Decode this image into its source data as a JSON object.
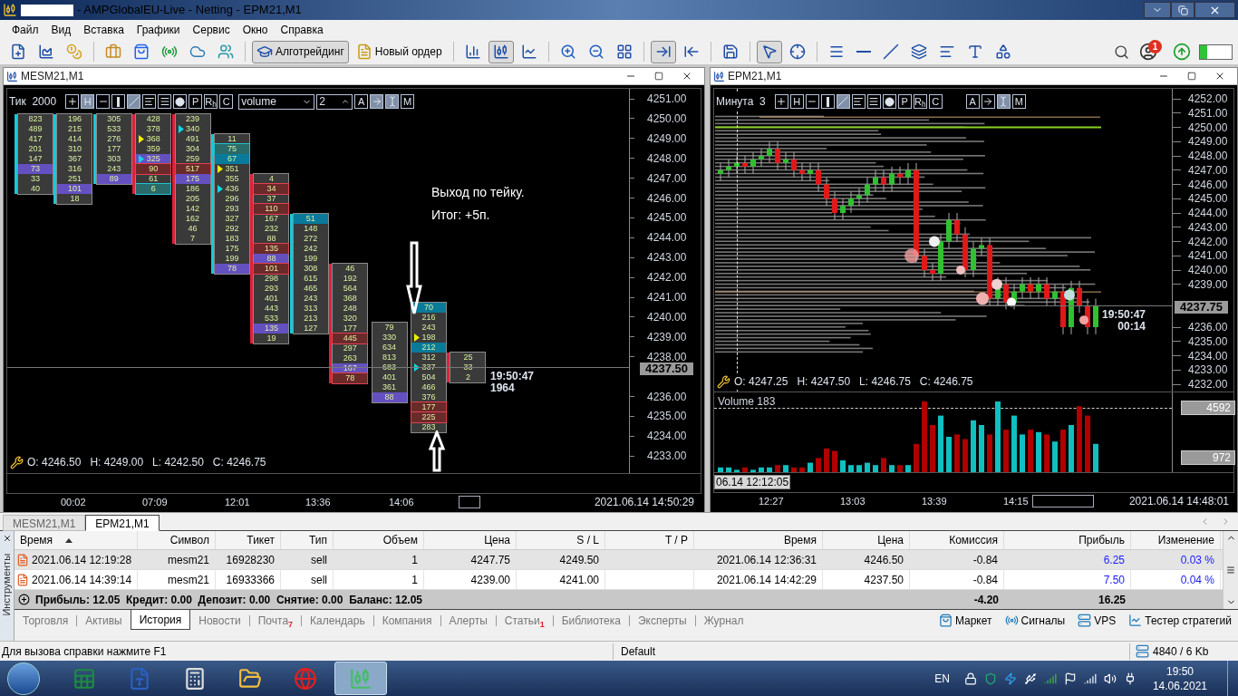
{
  "window": {
    "title": "- AMPGlobalEU-Live - Netting - EPM21,M1"
  },
  "menu": [
    "Файл",
    "Вид",
    "Вставка",
    "Графики",
    "Сервис",
    "Окно",
    "Справка"
  ],
  "toolbar": [
    {
      "kind": "new-chart",
      "pressed": false
    },
    {
      "kind": "templates",
      "pressed": false
    },
    {
      "kind": "profiles",
      "pressed": false
    },
    {
      "kind": "sep"
    },
    {
      "kind": "market",
      "pressed": false
    },
    {
      "kind": "shop",
      "pressed": false
    },
    {
      "kind": "signals",
      "pressed": false
    },
    {
      "kind": "vps",
      "pressed": false
    },
    {
      "kind": "community",
      "pressed": false
    },
    {
      "kind": "sep"
    },
    {
      "kind": "algo",
      "label": "Алготрейдинг",
      "pressed": true
    },
    {
      "kind": "order",
      "label": "Новый ордер",
      "pressed": false
    },
    {
      "kind": "sep"
    },
    {
      "kind": "bars",
      "pressed": false
    },
    {
      "kind": "candles",
      "pressed": true
    },
    {
      "kind": "line",
      "pressed": false
    },
    {
      "kind": "sep"
    },
    {
      "kind": "zoom-in",
      "pressed": false
    },
    {
      "kind": "zoom-out",
      "pressed": false
    },
    {
      "kind": "tile",
      "pressed": false
    },
    {
      "kind": "sep"
    },
    {
      "kind": "autoscroll",
      "pressed": true
    },
    {
      "kind": "shift",
      "pressed": false
    },
    {
      "kind": "sep"
    },
    {
      "kind": "save",
      "pressed": false
    },
    {
      "kind": "sep"
    },
    {
      "kind": "cursor",
      "pressed": true
    },
    {
      "kind": "crosshair",
      "pressed": false
    },
    {
      "kind": "sep"
    },
    {
      "kind": "vline",
      "pressed": false
    },
    {
      "kind": "hline",
      "pressed": false
    },
    {
      "kind": "trend",
      "pressed": false
    },
    {
      "kind": "channel",
      "pressed": false
    },
    {
      "kind": "fibo",
      "pressed": false
    },
    {
      "kind": "text",
      "pressed": false
    },
    {
      "kind": "shapes",
      "pressed": false
    }
  ],
  "notifications": {
    "count": "1"
  },
  "left_chart": {
    "title": "MESM21,M1",
    "period": "Тик",
    "size": "2000",
    "tools": [
      {
        "kind": "plus",
        "on": false
      },
      {
        "kind": "letter",
        "label": "H",
        "on": true
      },
      {
        "kind": "minus",
        "on": false
      },
      {
        "kind": "bar",
        "on": false
      },
      {
        "kind": "slash",
        "on": true
      },
      {
        "kind": "lines",
        "on": false
      },
      {
        "kind": "fibo",
        "on": false
      },
      {
        "kind": "dot",
        "on": false
      },
      {
        "kind": "letter",
        "label": "P",
        "on": false
      },
      {
        "kind": "letter",
        "label": "R$_{h}$",
        "on": false
      },
      {
        "kind": "letter",
        "label": "C",
        "on": false
      }
    ],
    "tools_right": [
      {
        "kind": "letter",
        "label": "A",
        "on": false
      },
      {
        "kind": "arrow",
        "on": true
      },
      {
        "kind": "ibeam",
        "on": true
      },
      {
        "kind": "letter",
        "label": "M",
        "on": false
      }
    ],
    "indicator_select": "volume",
    "step": "2",
    "columns": [
      {
        "color": "#18c8d8",
        "cells": [
          {
            "v": "823",
            "kind": "plain"
          },
          {
            "v": "489",
            "kind": "plain"
          },
          {
            "v": "417",
            "kind": "plain"
          },
          {
            "v": "201",
            "kind": "plain"
          },
          {
            "v": "147",
            "kind": "plain"
          },
          {
            "v": "73",
            "kind": "poc"
          },
          {
            "v": "33",
            "kind": "plain"
          },
          {
            "v": "40",
            "kind": "plain"
          }
        ]
      },
      {
        "color": "#18c8d8",
        "cells": [
          {
            "v": "196",
            "kind": "plain"
          },
          {
            "v": "215",
            "kind": "plain"
          },
          {
            "v": "414",
            "kind": "plain"
          },
          {
            "v": "310",
            "kind": "plain"
          },
          {
            "v": "367",
            "kind": "plain"
          },
          {
            "v": "316",
            "kind": "plain"
          },
          {
            "v": "251",
            "kind": "plain"
          },
          {
            "v": "101",
            "kind": "poc"
          },
          {
            "v": "18",
            "kind": "plain"
          }
        ]
      },
      {
        "color": "#18c8d8",
        "cells": [
          {
            "v": "305",
            "kind": "plain"
          },
          {
            "v": "533",
            "kind": "plain"
          },
          {
            "v": "276",
            "kind": "plain"
          },
          {
            "v": "177",
            "kind": "plain"
          },
          {
            "v": "303",
            "kind": "plain"
          },
          {
            "v": "243",
            "kind": "plain"
          },
          {
            "v": "89",
            "kind": "poc"
          }
        ]
      },
      {
        "color": "#e0203a",
        "cells": [
          {
            "v": "428",
            "kind": "plain"
          },
          {
            "v": "378",
            "kind": "plain"
          },
          {
            "v": "368",
            "kind": "plain",
            "color": "#f0f000"
          },
          {
            "v": "359",
            "kind": "plain"
          },
          {
            "v": "325",
            "kind": "poc",
            "color": "#10d8e8"
          },
          {
            "v": "90",
            "kind": "bid-box"
          },
          {
            "v": "61",
            "kind": "plain"
          },
          {
            "v": "6",
            "kind": "ask-box"
          }
        ]
      },
      {
        "color": "#e0203a",
        "cells": [
          {
            "v": "239",
            "kind": "plain"
          },
          {
            "v": "340",
            "kind": "plain",
            "color": "#10d8e8"
          },
          {
            "v": "491",
            "kind": "plain"
          },
          {
            "v": "304",
            "kind": "plain"
          },
          {
            "v": "259",
            "kind": "plain"
          },
          {
            "v": "517",
            "kind": "bid-box"
          },
          {
            "v": "175",
            "kind": "poc"
          },
          {
            "v": "186",
            "kind": "plain"
          },
          {
            "v": "205",
            "kind": "plain"
          },
          {
            "v": "142",
            "kind": "plain"
          },
          {
            "v": "162",
            "kind": "plain"
          },
          {
            "v": "46",
            "kind": "plain"
          },
          {
            "v": "7",
            "kind": "plain"
          }
        ]
      },
      {
        "color": "#18c8d8",
        "cells": [
          {
            "v": "11",
            "kind": "plain"
          },
          {
            "v": "75",
            "kind": "ask-box"
          },
          {
            "v": "67",
            "kind": "ask"
          },
          {
            "v": "351",
            "kind": "plain",
            "color": "#f0f000"
          },
          {
            "v": "355",
            "kind": "plain"
          },
          {
            "v": "436",
            "kind": "plain",
            "color": "#10d8e8"
          },
          {
            "v": "296",
            "kind": "plain"
          },
          {
            "v": "293",
            "kind": "plain"
          },
          {
            "v": "327",
            "kind": "plain"
          },
          {
            "v": "292",
            "kind": "plain"
          },
          {
            "v": "183",
            "kind": "plain"
          },
          {
            "v": "175",
            "kind": "plain"
          },
          {
            "v": "199",
            "kind": "plain"
          },
          {
            "v": "78",
            "kind": "poc"
          }
        ]
      },
      {
        "color": "#e0203a",
        "cells": [
          {
            "v": "4",
            "kind": "plain"
          },
          {
            "v": "34",
            "kind": "bid-box"
          },
          {
            "v": "37",
            "kind": "plain"
          },
          {
            "v": "110",
            "kind": "bid-box"
          },
          {
            "v": "167",
            "kind": "plain"
          },
          {
            "v": "232",
            "kind": "plain"
          },
          {
            "v": "88",
            "kind": "plain"
          },
          {
            "v": "135",
            "kind": "bid-box"
          },
          {
            "v": "88",
            "kind": "poc"
          },
          {
            "v": "101",
            "kind": "bid-box"
          },
          {
            "v": "298",
            "kind": "plain"
          },
          {
            "v": "293",
            "kind": "plain"
          },
          {
            "v": "401",
            "kind": "plain"
          },
          {
            "v": "443",
            "kind": "plain"
          },
          {
            "v": "533",
            "kind": "plain"
          },
          {
            "v": "135",
            "kind": "poc"
          },
          {
            "v": "19",
            "kind": "plain"
          }
        ]
      },
      {
        "color": "#18c8d8",
        "cells": [
          {
            "v": "51",
            "kind": "ask"
          },
          {
            "v": "148",
            "kind": "plain"
          },
          {
            "v": "272",
            "kind": "plain"
          },
          {
            "v": "242",
            "kind": "plain"
          },
          {
            "v": "199",
            "kind": "plain"
          },
          {
            "v": "308",
            "kind": "plain"
          },
          {
            "v": "615",
            "kind": "plain"
          },
          {
            "v": "465",
            "kind": "plain"
          },
          {
            "v": "243",
            "kind": "plain"
          },
          {
            "v": "313",
            "kind": "plain"
          },
          {
            "v": "213",
            "kind": "plain"
          },
          {
            "v": "127",
            "kind": "plain"
          }
        ]
      },
      {
        "color": "#e0203a",
        "cells": [
          {
            "v": "46",
            "kind": "plain"
          },
          {
            "v": "192",
            "kind": "plain"
          },
          {
            "v": "564",
            "kind": "plain"
          },
          {
            "v": "368",
            "kind": "plain"
          },
          {
            "v": "248",
            "kind": "plain"
          },
          {
            "v": "320",
            "kind": "plain"
          },
          {
            "v": "177",
            "kind": "plain"
          },
          {
            "v": "445",
            "kind": "bid-box"
          },
          {
            "v": "297",
            "kind": "plain"
          },
          {
            "v": "263",
            "kind": "plain"
          },
          {
            "v": "167",
            "kind": "poc"
          },
          {
            "v": "78",
            "kind": "bid-box"
          }
        ]
      },
      {
        "cells": [
          {
            "v": "79",
            "kind": "plain"
          },
          {
            "v": "330",
            "kind": "plain"
          },
          {
            "v": "634",
            "kind": "plain"
          },
          {
            "v": "813",
            "kind": "plain"
          },
          {
            "v": "683",
            "kind": "plain"
          },
          {
            "v": "401",
            "kind": "plain"
          },
          {
            "v": "361",
            "kind": "plain"
          },
          {
            "v": "88",
            "kind": "poc"
          }
        ]
      },
      {
        "cells": [
          {
            "v": "70",
            "kind": "ask"
          },
          {
            "v": "216",
            "kind": "plain"
          },
          {
            "v": "243",
            "kind": "plain"
          },
          {
            "v": "198",
            "kind": "plain",
            "color": "#f0f000"
          },
          {
            "v": "212",
            "kind": "ask"
          },
          {
            "v": "312",
            "kind": "plain"
          },
          {
            "v": "337",
            "kind": "plain",
            "color": "#10d8e8"
          },
          {
            "v": "504",
            "kind": "plain"
          },
          {
            "v": "466",
            "kind": "plain"
          },
          {
            "v": "376",
            "kind": "plain"
          },
          {
            "v": "177",
            "kind": "bid-box"
          },
          {
            "v": "225",
            "kind": "bid-box"
          },
          {
            "v": "283",
            "kind": "plain"
          }
        ]
      },
      {
        "color": "#e0203a",
        "cells": [
          {
            "v": "25",
            "kind": "plain"
          },
          {
            "v": "33",
            "kind": "plain"
          },
          {
            "v": "2",
            "kind": "plain"
          }
        ]
      }
    ],
    "note": [
      "Выход по тейку.",
      "Итог: +5п."
    ],
    "timer": [
      "19:50:47",
      "1964"
    ],
    "current_price": "4237.50",
    "ohlc": "O: 4246.50   H: 4249.00   L: 4242.50   C: 4246.75",
    "price_axis": [
      "4251.00",
      "4250.00",
      "4249.00",
      "4248.00",
      "4247.00",
      "4246.00",
      "4245.00",
      "4244.00",
      "4243.00",
      "4242.00",
      "4241.00",
      "4240.00",
      "4239.00",
      "4238.00",
      "4236.00",
      "4235.00",
      "4234.00",
      "4233.00"
    ],
    "time_axis": [
      "00:02",
      "07:09",
      "12:01",
      "13:36",
      "14:06"
    ],
    "last_time": "2021.06.14 14:50:29"
  },
  "right_chart": {
    "title": "EPM21,M1",
    "period": "Минута",
    "size": "3",
    "tools": [
      {
        "kind": "plus",
        "on": false
      },
      {
        "kind": "letter",
        "label": "H",
        "on": false
      },
      {
        "kind": "minus",
        "on": false
      },
      {
        "kind": "bar",
        "on": false
      },
      {
        "kind": "slash",
        "on": true
      },
      {
        "kind": "lines",
        "on": false
      },
      {
        "kind": "fibo",
        "on": false
      },
      {
        "kind": "dot",
        "on": false
      },
      {
        "kind": "letter",
        "label": "P",
        "on": false
      },
      {
        "kind": "letter",
        "label": "R$_{h}$",
        "on": false
      },
      {
        "kind": "letter",
        "label": "C",
        "on": false
      }
    ],
    "tools_right": [
      {
        "kind": "letter",
        "label": "A",
        "on": false
      },
      {
        "kind": "arrow",
        "on": false
      },
      {
        "kind": "ibeam",
        "on": true
      },
      {
        "kind": "letter",
        "label": "M",
        "on": false
      }
    ],
    "current_price": "4237.75",
    "timer": [
      "19:50:47",
      "00:14"
    ],
    "ohlc": "O: 4247.25   H: 4247.50   L: 4246.75   C: 4246.75",
    "price_axis": [
      "4252.00",
      "4251.00",
      "4250.00",
      "4249.00",
      "4248.00",
      "4247.00",
      "4246.00",
      "4245.00",
      "4244.00",
      "4243.00",
      "4242.00",
      "4241.00",
      "4240.00",
      "4239.00",
      "4236.00",
      "4235.00",
      "4234.00",
      "4233.00",
      "4232.00"
    ],
    "volume_label": "Volume 183",
    "volume_axis": [
      "4592",
      "972"
    ],
    "crosshair_time": "06.14 12:12:05",
    "time_axis": [
      "12:27",
      "13:03",
      "13:39",
      "14:15"
    ],
    "last_time": "2021.06.14 14:48:01"
  },
  "chart_tabs": [
    {
      "label": "MESM21,M1",
      "selected": false
    },
    {
      "label": "EPM21,M1",
      "selected": true
    }
  ],
  "side_label": "Инструменты",
  "table": {
    "columns": [
      "Время",
      "Символ",
      "Тикет",
      "Тип",
      "Объем",
      "Цена",
      "S / L",
      "T / P",
      "Время",
      "Цена",
      "Комиссия",
      "Прибыль",
      "Изменение"
    ],
    "rows": [
      {
        "selected": true,
        "cells": [
          "2021.06.14 12:19:28",
          "mesm21",
          "16928230",
          "sell",
          "1",
          "4247.75",
          "4249.50",
          "",
          "2021.06.14 12:36:31",
          "4246.50",
          "-0.84",
          "6.25",
          "0.03 %"
        ]
      },
      {
        "selected": false,
        "cells": [
          "2021.06.14 14:39:14",
          "mesm21",
          "16933366",
          "sell",
          "1",
          "4239.00",
          "4241.00",
          "",
          "2021.06.14 14:42:29",
          "4237.50",
          "-0.84",
          "7.50",
          "0.04 %"
        ]
      }
    ],
    "summary": "Прибыль: 12.05  Кредит: 0.00  Депозит: 0.00  Снятие: 0.00  Баланс: 12.05",
    "summary_commission": "-4.20",
    "summary_profit": "16.25"
  },
  "bottom_tabs": [
    {
      "label": "Торговля",
      "selected": false
    },
    {
      "label": "Активы",
      "selected": false
    },
    {
      "label": "История",
      "selected": true
    },
    {
      "label": "Новости",
      "selected": false
    },
    {
      "label": "Почта",
      "badge": "7",
      "selected": false
    },
    {
      "label": "Календарь",
      "selected": false
    },
    {
      "label": "Компания",
      "selected": false
    },
    {
      "label": "Алерты",
      "selected": false
    },
    {
      "label": "Статьи",
      "badge": "1",
      "selected": false
    },
    {
      "label": "Библиотека",
      "selected": false
    },
    {
      "label": "Эксперты",
      "selected": false
    },
    {
      "label": "Журнал",
      "selected": false
    }
  ],
  "services": [
    {
      "kind": "market",
      "label": "Маркет"
    },
    {
      "kind": "signals",
      "label": "Сигналы"
    },
    {
      "kind": "vps",
      "label": "VPS"
    },
    {
      "kind": "tester",
      "label": "Тестер стратегий"
    }
  ],
  "status_bar": {
    "help": "Для вызова справки нажмите F1",
    "profile": "Default",
    "traffic": "4840 / 6 Kb"
  },
  "taskbar": {
    "apps": [
      {
        "kind": "sheet",
        "active": false
      },
      {
        "kind": "doc",
        "active": false
      },
      {
        "kind": "calc",
        "active": false
      },
      {
        "kind": "folder",
        "active": false
      },
      {
        "kind": "browser",
        "active": false
      },
      {
        "kind": "terminal",
        "active": true
      }
    ],
    "lang": "EN",
    "time": "19:50",
    "date": "14.06.2021"
  }
}
